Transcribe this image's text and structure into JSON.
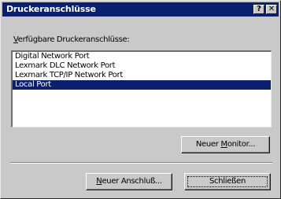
{
  "window": {
    "title": "Druckeranschlüsse",
    "help_glyph": "?",
    "close_glyph": "✕"
  },
  "ports_label": {
    "mnemonic": "V",
    "rest": "erfügbare Druckeranschlüsse:"
  },
  "ports": [
    {
      "label": "Digital Network Port",
      "selected": false
    },
    {
      "label": "Lexmark DLC Network Port",
      "selected": false
    },
    {
      "label": "Lexmark TCP/IP Network Port",
      "selected": false
    },
    {
      "label": "Local Port",
      "selected": true
    }
  ],
  "buttons": {
    "new_monitor": {
      "before": "Neuer ",
      "mnemonic": "M",
      "after": "onitor..."
    },
    "new_port": {
      "before": "",
      "mnemonic": "N",
      "after": "euer Anschluß..."
    },
    "close": "Schließen"
  },
  "colors": {
    "titlebar": "#0a1f6e",
    "selection": "#0a1f6e",
    "face": "#c9c9c9"
  }
}
